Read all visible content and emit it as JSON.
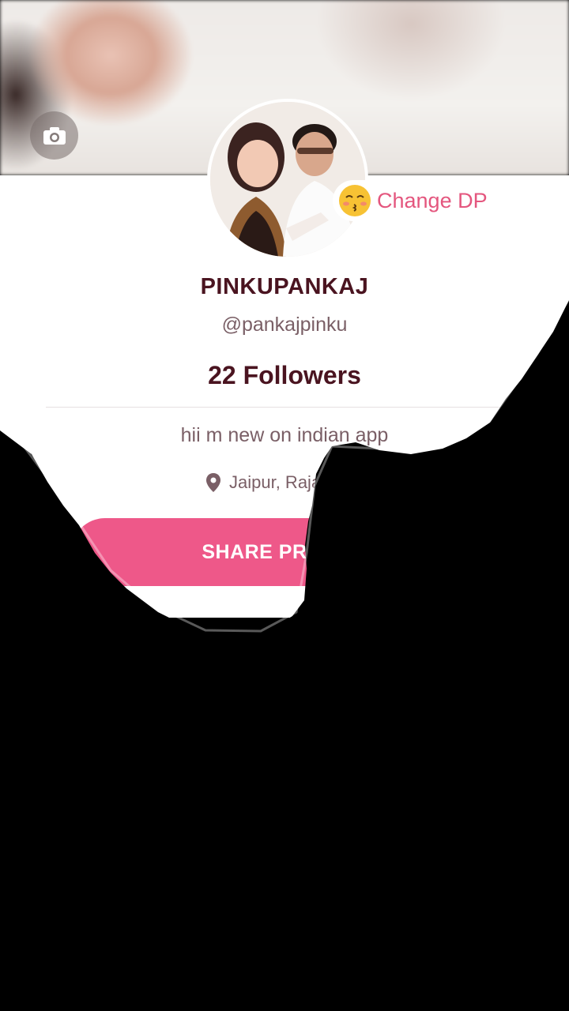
{
  "profile": {
    "name": "PINKUPANKAJ",
    "handle": "@pankajpinku",
    "followers": "22 Followers",
    "bio": "hii m new on indian app",
    "location": "Jaipur, Rajasthan"
  },
  "actions": {
    "change_dp": "Change DP",
    "share": "SHARE PROFILE"
  },
  "icons": {
    "camera": "camera-icon",
    "location": "location-pin-icon",
    "emoji": "kissing-face-icon"
  },
  "colors": {
    "accent": "#ee5889",
    "text_dark": "#4a1420",
    "text_muted": "#7a5f66"
  }
}
